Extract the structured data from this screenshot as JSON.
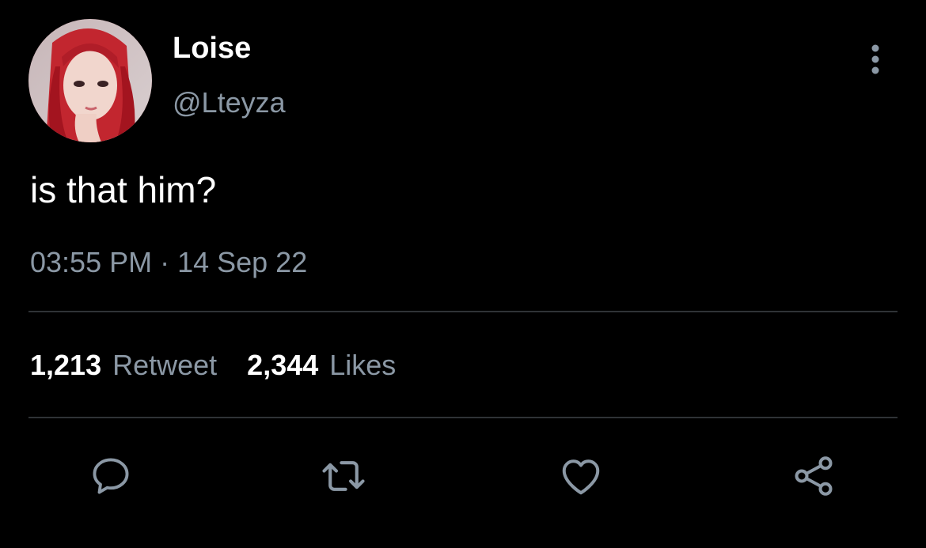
{
  "tweet": {
    "author": {
      "display_name": "Loise",
      "handle": "@Lteyza",
      "avatar": "avatar-photo"
    },
    "text": "is that him?",
    "timestamp": "03:55 PM · 14 Sep 22",
    "stats": {
      "retweets_count": "1,213",
      "retweets_label": "Retweet",
      "likes_count": "2,344",
      "likes_label": "Likes"
    },
    "menu_icon": "more-vertical-icon",
    "actions": [
      {
        "name": "reply",
        "icon": "reply-icon"
      },
      {
        "name": "retweet",
        "icon": "retweet-icon"
      },
      {
        "name": "like",
        "icon": "heart-icon"
      },
      {
        "name": "share",
        "icon": "share-icon"
      }
    ]
  },
  "colors": {
    "background": "#000000",
    "primary_text": "#ffffff",
    "secondary_text": "#8b98a5",
    "divider": "#2f3336",
    "icon": "#8b98a5"
  }
}
